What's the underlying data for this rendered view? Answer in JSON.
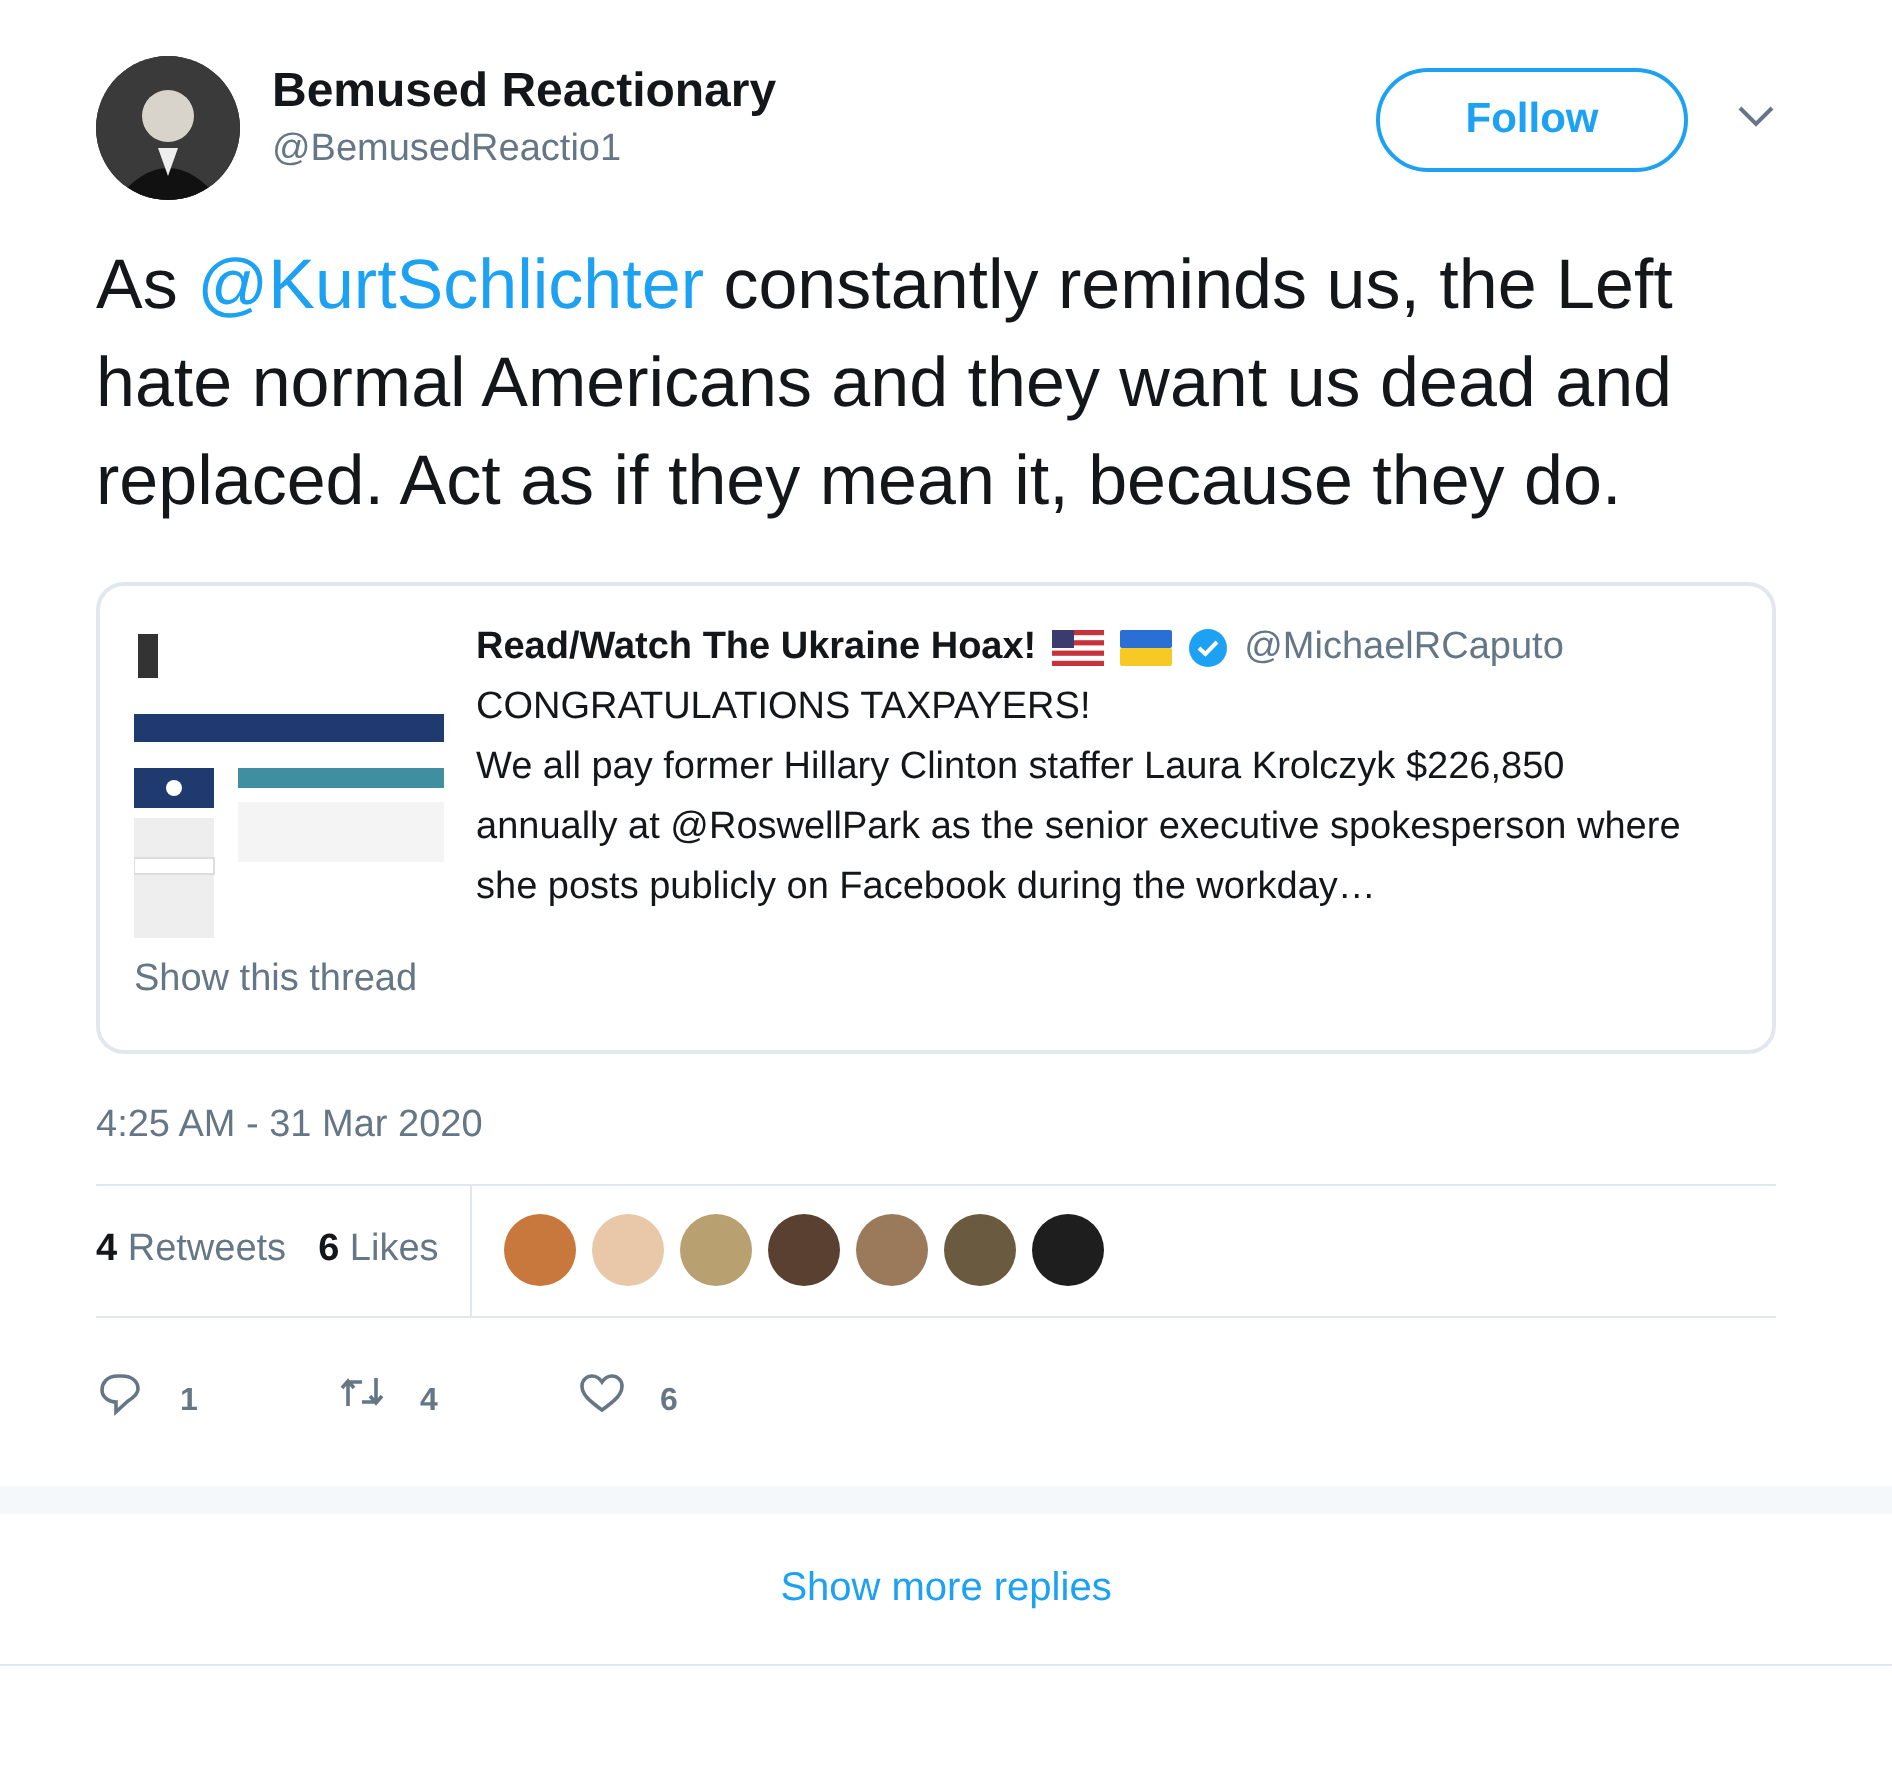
{
  "author": {
    "name": "Bemused Reactionary",
    "handle": "@BemusedReactio1"
  },
  "follow_button": "Follow",
  "tweet_parts": [
    {
      "kind": "text",
      "text": "As "
    },
    {
      "kind": "mention",
      "text": "@KurtSchlichter"
    },
    {
      "kind": "text",
      "text": " constantly reminds us, the Left hate normal Americans and they want us dead and replaced. Act as if they mean it, because they do."
    }
  ],
  "quoted": {
    "thumbnail": {
      "kind": "picture"
    },
    "name": "Read/Watch The Ukraine Hoax!",
    "verified": true,
    "handle": "@MichaelRCaputo",
    "lines": [
      "CONGRATULATIONS TAXPAYERS!",
      "We all pay former Hillary Clinton staffer Laura Krolczyk $226,850 annually at @RoswellPark as the senior executive spokesperson where she posts publicly on Facebook during the workday…"
    ],
    "show_thread": "Show this thread"
  },
  "timestamp": "4:25 AM - 31 Mar 2020",
  "stats": [
    {
      "count": "4",
      "label": "Retweets"
    },
    {
      "count": "6",
      "label": "Likes"
    }
  ],
  "likers": [
    {
      "color": "#c8783c"
    },
    {
      "color": "#e8c8a8"
    },
    {
      "color": "#b8a070"
    },
    {
      "color": "#5a4030"
    },
    {
      "color": "#9a7a5a"
    },
    {
      "color": "#6a5a40"
    },
    {
      "color": "#1e1e1e"
    }
  ],
  "actions": [
    {
      "kind": "reply",
      "count": "1"
    },
    {
      "kind": "retweet",
      "count": "4"
    },
    {
      "kind": "like",
      "count": "6"
    }
  ],
  "show_more": "Show more replies"
}
